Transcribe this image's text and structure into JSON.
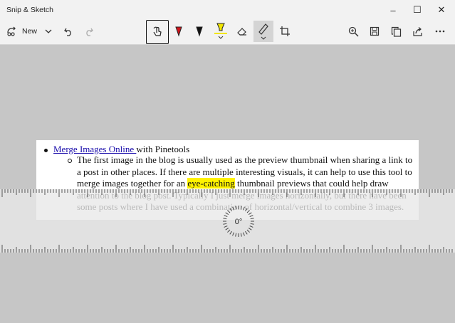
{
  "window": {
    "title": "Snip & Sketch",
    "controls": {
      "minimize": "–",
      "maximize": "☐",
      "close": "✕"
    }
  },
  "toolbar": {
    "new_label": "New",
    "tools": [
      "touch-writing",
      "ballpoint-pen",
      "pencil",
      "highlighter",
      "eraser",
      "ruler",
      "image-crop"
    ],
    "active_tool": "touch-writing",
    "pen_colors": {
      "ballpoint": "#d1131b",
      "pencil": "#111111",
      "highlighter": "#f2e600"
    },
    "actions": [
      "zoom",
      "save-as",
      "copy",
      "share",
      "see-more"
    ]
  },
  "document": {
    "link_text": "Merge Images Online ",
    "link_suffix": "with Pinetools",
    "para_before": "The first image in the blog is usually used as the preview thumbnail when sharing a link to a post in other places. If there are multiple interesting visuals, it can help to use this tool to merge images together for an ",
    "highlight_text": "eye-catching",
    "para_after": " thumbnail previews that could help draw attention to the blog post. Typically I just merge images horizontally, but there have been some posts where I have used a combination of horizontal/vertical to combine 3 images.",
    "highlight_color": "#fff200"
  },
  "ruler": {
    "angle_label": "0°",
    "angle_deg": 0
  },
  "colors": {
    "canvas": "#c6c6c6",
    "chrome": "#f2f2f2",
    "link": "#1a0dab"
  }
}
